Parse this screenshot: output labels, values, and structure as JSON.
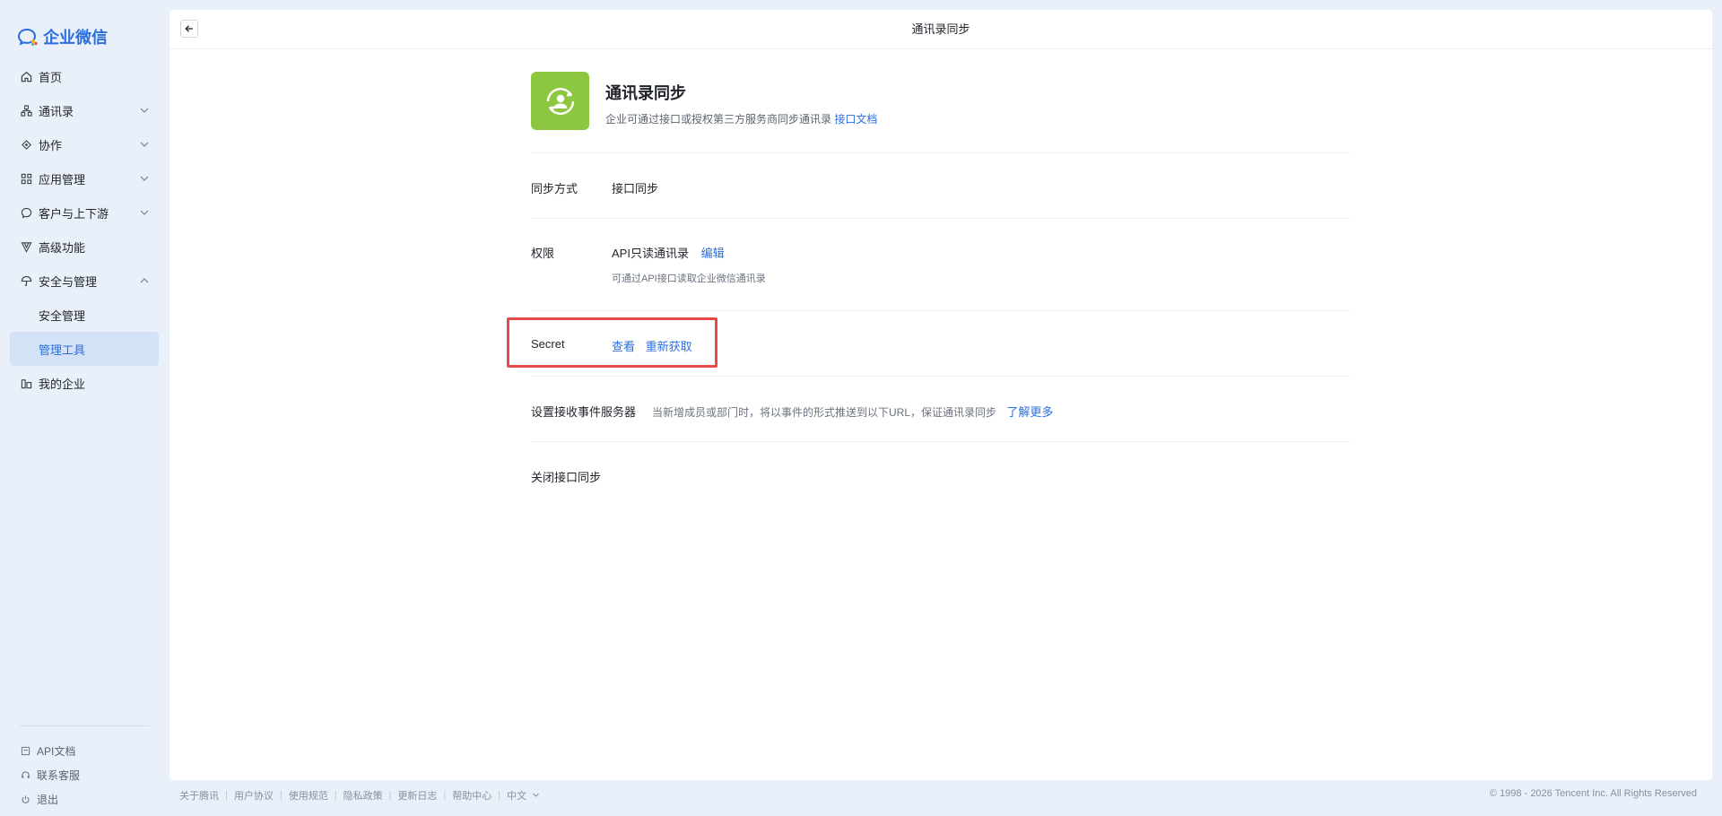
{
  "logo": {
    "text": "企业微信"
  },
  "sidebar": {
    "items": [
      {
        "label": "首页",
        "icon": "home-icon"
      },
      {
        "label": "通讯录",
        "icon": "org-icon",
        "expandable": true
      },
      {
        "label": "协作",
        "icon": "collab-icon",
        "expandable": true
      },
      {
        "label": "应用管理",
        "icon": "apps-icon",
        "expandable": true
      },
      {
        "label": "客户与上下游",
        "icon": "chat-icon",
        "expandable": true
      },
      {
        "label": "高级功能",
        "icon": "advanced-icon"
      },
      {
        "label": "安全与管理",
        "icon": "umbrella-icon",
        "expanded": true
      }
    ],
    "sub_items": [
      {
        "label": "安全管理"
      },
      {
        "label": "管理工具",
        "active": true
      }
    ],
    "last_item": {
      "label": "我的企业",
      "icon": "company-icon"
    },
    "bottom_links": [
      {
        "label": "API文档",
        "icon": "doc-icon"
      },
      {
        "label": "联系客服",
        "icon": "headset-icon"
      },
      {
        "label": "退出",
        "icon": "power-icon"
      }
    ]
  },
  "topbar": {
    "title": "通讯录同步"
  },
  "header": {
    "title": "通讯录同步",
    "desc": "企业可通过接口或授权第三方服务商同步通讯录",
    "doc_link": "接口文档"
  },
  "rows": {
    "sync_mode": {
      "label": "同步方式",
      "value": "接口同步"
    },
    "permission": {
      "label": "权限",
      "value": "API只读通讯录",
      "edit_link": "编辑",
      "hint": "可通过API接口读取企业微信通讯录"
    },
    "secret": {
      "label": "Secret",
      "view_link": "查看",
      "refresh_link": "重新获取"
    },
    "event_server": {
      "link": "设置接收事件服务器",
      "desc": "当新增成员或部门时，将以事件的形式推送到以下URL，保证通讯录同步",
      "more_link": "了解更多"
    },
    "close_sync": {
      "link": "关闭接口同步"
    }
  },
  "footer": {
    "links": [
      "关于腾讯",
      "用户协议",
      "使用规范",
      "隐私政策",
      "更新日志",
      "帮助中心"
    ],
    "language": "中文",
    "copyright": "© 1998 - 2026 Tencent Inc. All Rights Reserved"
  },
  "colors": {
    "accent": "#2a6fe0",
    "highlight": "#e84a4a",
    "app_icon": "#8dc63f"
  }
}
